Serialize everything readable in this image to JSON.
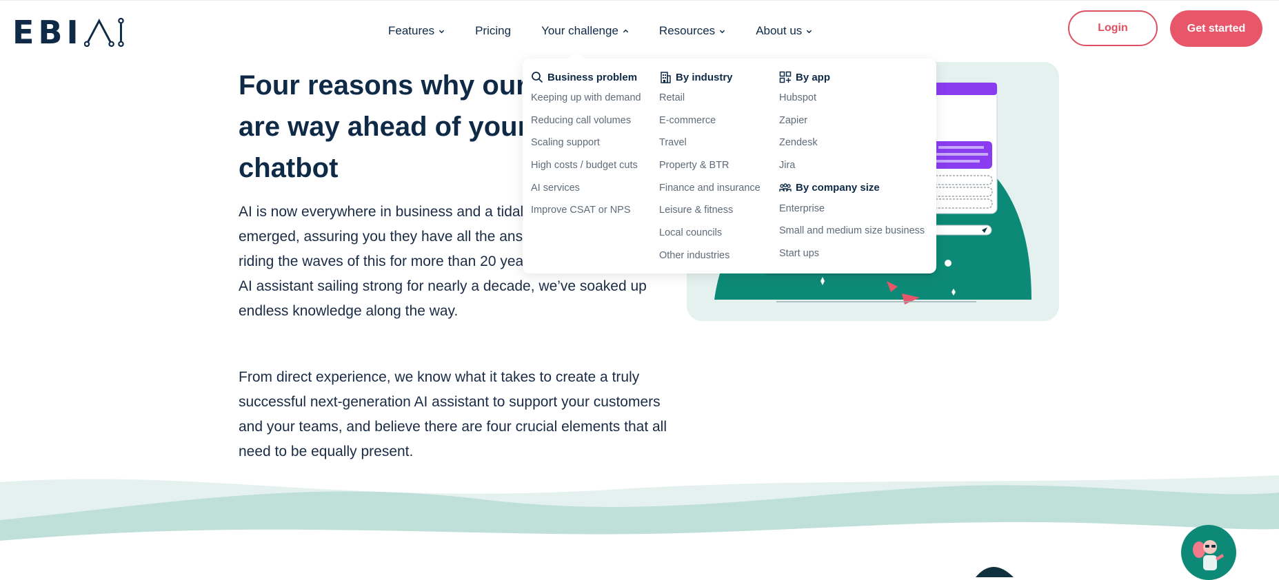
{
  "header": {
    "logo_text": "EBI",
    "nav": [
      {
        "label": "Features",
        "has_chevron": true,
        "expanded": false
      },
      {
        "label": "Pricing",
        "has_chevron": false,
        "expanded": false
      },
      {
        "label": "Your challenge",
        "has_chevron": true,
        "expanded": true
      },
      {
        "label": "Resources",
        "has_chevron": true,
        "expanded": false
      },
      {
        "label": "About us",
        "has_chevron": true,
        "expanded": false
      }
    ],
    "login_label": "Login",
    "get_started_label": "Get started"
  },
  "hero": {
    "title": "Four reasons why our assistants are way ahead of your basic chatbot",
    "paragraph_1": "AI is now everywhere in business and a tidal wave of providers has emerged, assuring you they have all the answers. We’ve been riding the waves of this for more than 20 years, and with our oldest AI assistant sailing strong for nearly a decade, we’ve soaked up endless knowledge along the way.",
    "paragraph_2": "From direct experience, we know what it takes to create a truly successful next-generation AI assistant to support your customers and your teams, and believe there are four crucial elements that all need to be equally present."
  },
  "dropdown": {
    "business_problem": {
      "heading": "Business problem",
      "icon": "search-icon",
      "items": [
        "Keeping up with demand",
        "Reducing call volumes",
        "Scaling support",
        "High costs / budget cuts",
        "AI services",
        "Improve CSAT or NPS"
      ]
    },
    "by_industry": {
      "heading": "By industry",
      "icon": "building-icon",
      "items": [
        "Retail",
        "E-commerce",
        "Travel",
        "Property & BTR",
        "Finance and insurance",
        "Leisure & fitness",
        "Local councils",
        "Other industries"
      ]
    },
    "by_app": {
      "heading": "By app",
      "icon": "apps-grid-icon",
      "items": [
        "Hubspot",
        "Zapier",
        "Zendesk",
        "Jira"
      ]
    },
    "by_company_size": {
      "heading": "By company size",
      "icon": "people-icon",
      "items": [
        "Enterprise",
        "Small and medium size business",
        "Start ups"
      ]
    }
  },
  "colors": {
    "brand_navy": "#0e2a47",
    "accent_red": "#e8566a",
    "teal": "#0d8a77",
    "illustration_bg": "#e4f1ef",
    "chat_purple": "#8a3cf0"
  }
}
